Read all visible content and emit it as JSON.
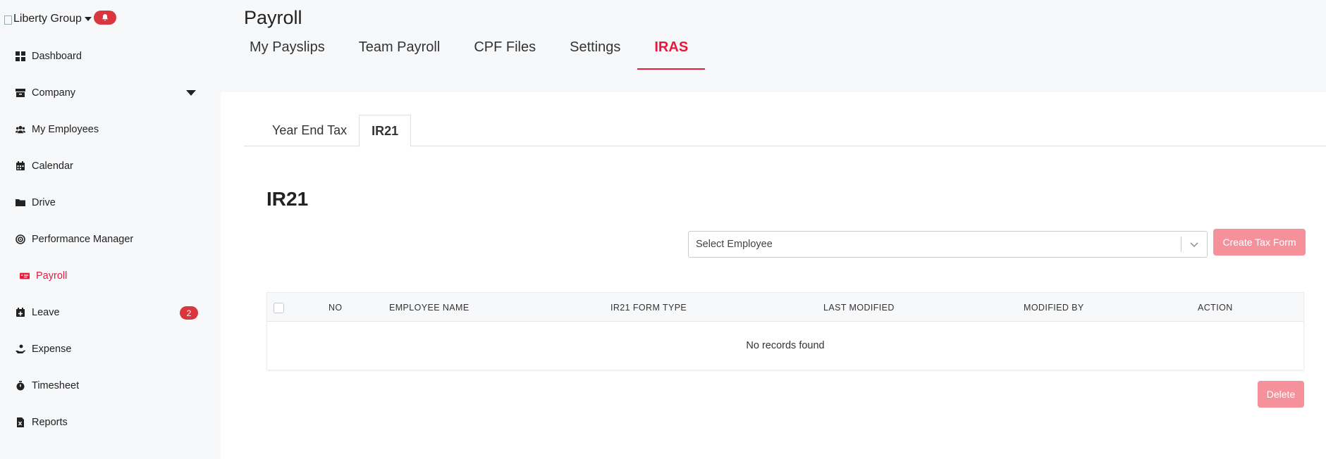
{
  "brand": {
    "logo_alt": "Liberty Group"
  },
  "sidebar": {
    "items": [
      {
        "label": "Dashboard",
        "icon": "dashboard-icon"
      },
      {
        "label": "Company",
        "icon": "archive-icon"
      },
      {
        "label": "My Employees",
        "icon": "users-icon"
      },
      {
        "label": "Calendar",
        "icon": "calendar-icon"
      },
      {
        "label": "Drive",
        "icon": "folder-icon"
      },
      {
        "label": "Performance Manager",
        "icon": "target-icon"
      },
      {
        "label": "Payroll",
        "icon": "money-bill-icon"
      },
      {
        "label": "Leave",
        "icon": "calendar-plus-icon",
        "badge": "2"
      },
      {
        "label": "Expense",
        "icon": "hand-coins-icon"
      },
      {
        "label": "Timesheet",
        "icon": "stopwatch-icon"
      },
      {
        "label": "Reports",
        "icon": "excel-file-icon"
      }
    ],
    "active": "Payroll"
  },
  "header": {
    "title": "Payroll",
    "tabs": [
      "My Payslips",
      "Team Payroll",
      "CPF Files",
      "Settings",
      "IRAS"
    ],
    "active_tab": "IRAS"
  },
  "content": {
    "sub_tabs": [
      "Year End Tax",
      "IR21"
    ],
    "active_sub_tab": "IR21",
    "section_title": "IR21",
    "select_placeholder": "Select Employee",
    "create_button": "Create Tax Form",
    "delete_button": "Delete",
    "table": {
      "columns": [
        "NO",
        "EMPLOYEE NAME",
        "IR21 FORM TYPE",
        "LAST MODIFIED",
        "MODIFIED BY",
        "ACTION"
      ],
      "empty_text": "No records found"
    }
  },
  "colors": {
    "accent": "#e8193c",
    "badge": "#d9363e",
    "button_disabled": "#f4919b",
    "sidebar_bg": "#f7f8fa"
  }
}
